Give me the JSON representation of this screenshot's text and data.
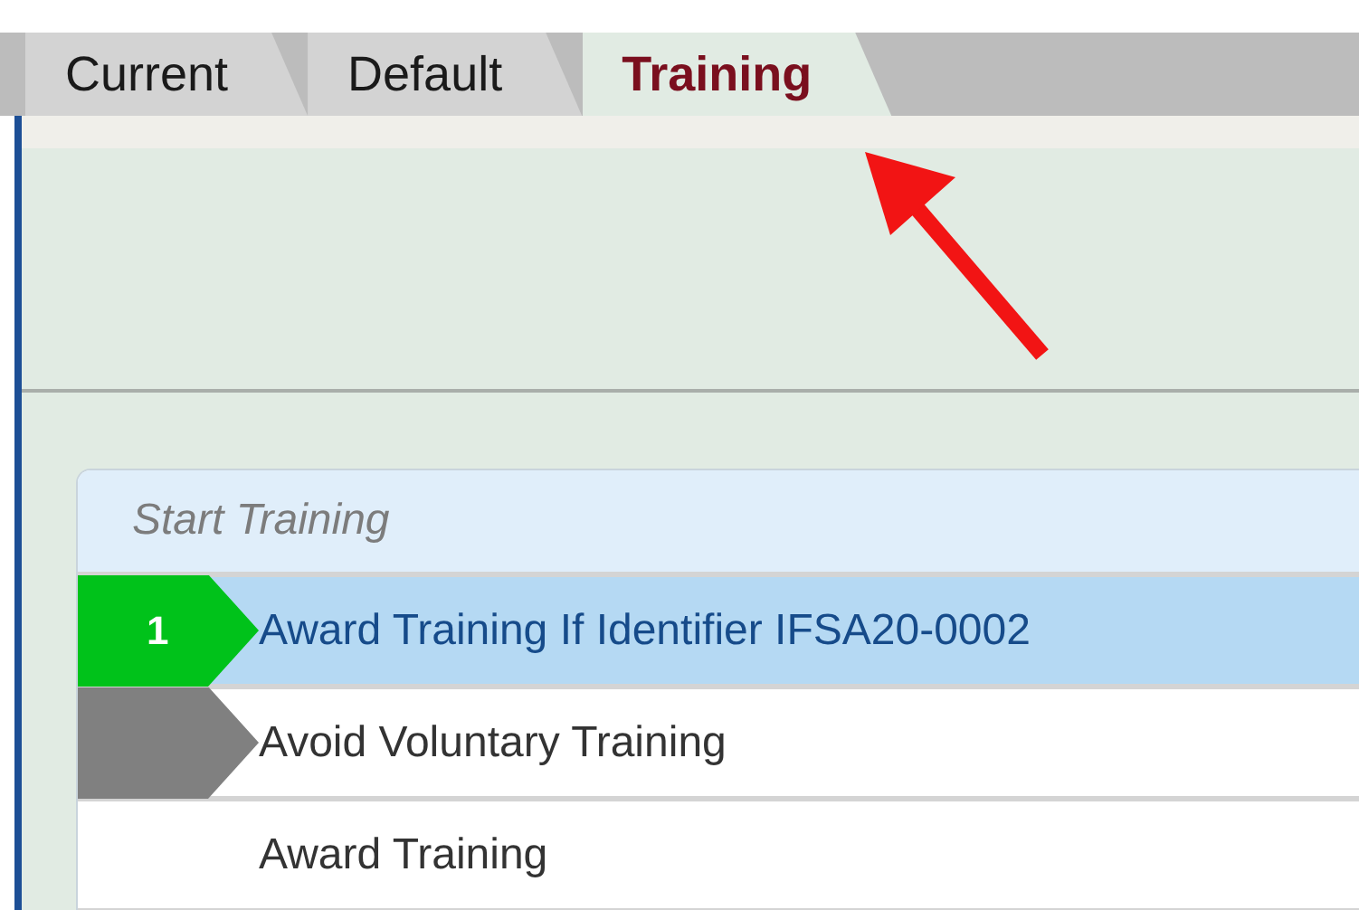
{
  "tabs": [
    {
      "label": "Current",
      "selected": false
    },
    {
      "label": "Default",
      "selected": false
    },
    {
      "label": "Training",
      "selected": true
    }
  ],
  "panel": {
    "header": "Start Training",
    "rows": [
      {
        "kind": "marker",
        "label": "Award Training If Identifier IFSA20-0002",
        "number": "1",
        "color": "#00c21a",
        "selected": true
      },
      {
        "kind": "marker",
        "label": "Avoid Voluntary Training",
        "color": "#808080",
        "selected": false
      },
      {
        "kind": "plain",
        "label": "Award Training",
        "selected": false
      }
    ]
  }
}
